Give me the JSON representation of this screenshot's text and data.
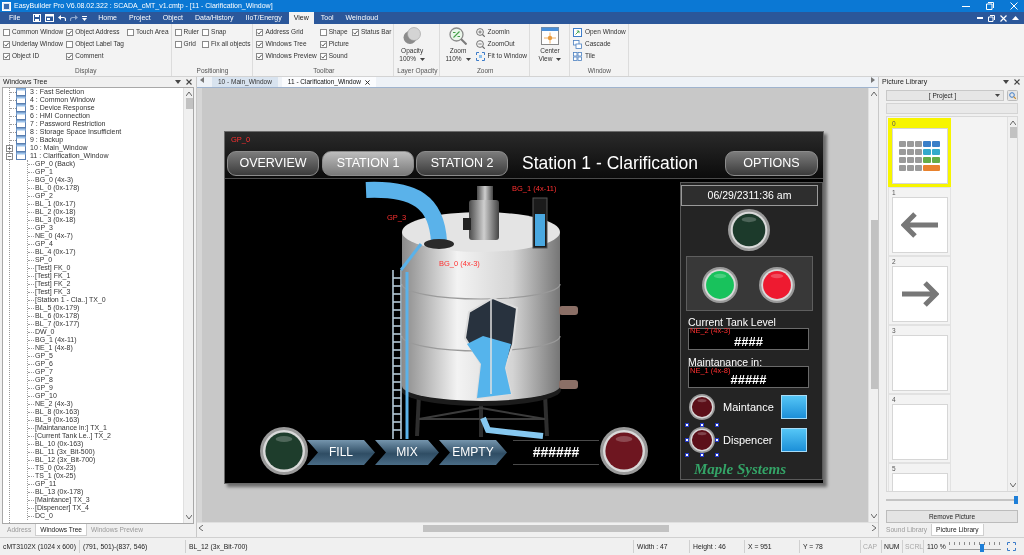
{
  "window": {
    "title": "EasyBuilder Pro V6.08.02.322 : SCADA_cMT_v1.cmtp - [11 - Clarification_Window]"
  },
  "menu": {
    "file": "File",
    "tabs": [
      {
        "label": "Home",
        "selected": false
      },
      {
        "label": "Project",
        "selected": false
      },
      {
        "label": "Object",
        "selected": false
      },
      {
        "label": "Data/History",
        "selected": false
      },
      {
        "label": "IIoT/Energy",
        "selected": false
      },
      {
        "label": "View",
        "selected": true
      },
      {
        "label": "Tool",
        "selected": false
      },
      {
        "label": "Weincloud",
        "selected": false
      }
    ]
  },
  "ribbon": [
    {
      "label": "Display",
      "columns": [
        [
          {
            "kind": "check",
            "label": "Common Window",
            "checked": false
          },
          {
            "kind": "check",
            "label": "Underlay Window",
            "checked": true
          },
          {
            "kind": "check",
            "label": "Object ID",
            "checked": true
          }
        ],
        [
          {
            "kind": "check",
            "label": "Object Address",
            "checked": true
          },
          {
            "kind": "check",
            "label": "Object Label Tag",
            "checked": false
          },
          {
            "kind": "check",
            "label": "Comment",
            "checked": true
          }
        ],
        [
          {
            "kind": "check",
            "label": "Touch Area",
            "checked": false
          }
        ]
      ]
    },
    {
      "label": "Positioning",
      "columns": [
        [
          {
            "kind": "check",
            "label": "Ruler",
            "checked": false
          },
          {
            "kind": "check",
            "label": "Grid",
            "checked": false
          }
        ],
        [
          {
            "kind": "check",
            "label": "Snap",
            "checked": false
          },
          {
            "kind": "check",
            "label": "Fix all objects",
            "checked": false
          }
        ]
      ]
    },
    {
      "label": "Toolbar",
      "columns": [
        [
          {
            "kind": "check",
            "label": "Address Grid",
            "checked": true
          },
          {
            "kind": "check",
            "label": "Windows Tree",
            "checked": true
          },
          {
            "kind": "check",
            "label": "Windows Preview",
            "checked": true
          }
        ],
        [
          {
            "kind": "check",
            "label": "Shape",
            "checked": false
          },
          {
            "kind": "check",
            "label": "Picture",
            "checked": true
          },
          {
            "kind": "check",
            "label": "Sound",
            "checked": true
          }
        ],
        [
          {
            "kind": "check",
            "label": "Status Bar",
            "checked": true
          }
        ]
      ]
    },
    {
      "label": "Layer Opacity",
      "columns": [
        [
          {
            "kind": "large",
            "label": "Opacity",
            "value": "100%"
          }
        ]
      ]
    },
    {
      "label": "Zoom",
      "columns": [
        [
          {
            "kind": "large",
            "label": "Zoom",
            "value": "110%"
          }
        ],
        [
          {
            "kind": "command",
            "label": "ZoomIn"
          },
          {
            "kind": "command",
            "label": "ZoomOut"
          },
          {
            "kind": "command",
            "label": "Fit to Window"
          }
        ]
      ]
    },
    {
      "columns": [
        [
          {
            "kind": "large",
            "label": "Center View"
          }
        ]
      ]
    },
    {
      "label": "Window",
      "columns": [
        [
          {
            "kind": "command",
            "label": "Open Window"
          },
          {
            "kind": "command",
            "label": "Cascade"
          },
          {
            "kind": "command",
            "label": "Tile"
          }
        ]
      ]
    }
  ],
  "windows_tree": {
    "title": "Windows Tree",
    "items": [
      {
        "label": "3 : Fast Selection"
      },
      {
        "label": "4 : Common Window"
      },
      {
        "label": "5 : Device Response"
      },
      {
        "label": "6 : HMI Connection"
      },
      {
        "label": "7 : Password Restriction"
      },
      {
        "label": "8 : Storage Space Insufficient"
      },
      {
        "label": "9 : Backup"
      },
      {
        "label": "10 : Main_Window",
        "expanded": false
      },
      {
        "label": "11 : Clarification_Window",
        "expanded": true,
        "children": [
          {
            "label": "GP_0 (Back)"
          },
          {
            "label": "GP_1"
          },
          {
            "label": "BG_0 (4x-3)"
          },
          {
            "label": "BL_0 (0x-178)"
          },
          {
            "label": "GP_2"
          },
          {
            "label": "BL_1 (0x-17)"
          },
          {
            "label": "BL_2 (0x-18)"
          },
          {
            "label": "BL_3 (0x-18)"
          },
          {
            "label": "GP_3"
          },
          {
            "label": "NE_0 (4x-7)"
          },
          {
            "label": "GP_4"
          },
          {
            "label": "BL_4 (0x-17)"
          },
          {
            "label": "SP_0"
          },
          {
            "label": "[Test] FK_0"
          },
          {
            "label": "[Test] FK_1"
          },
          {
            "label": "[Test] FK_2"
          },
          {
            "label": "[Test] FK_3"
          },
          {
            "label": "[Station 1 - Cla..] TX_0"
          },
          {
            "label": "BL_5 (0x-179)"
          },
          {
            "label": "BL_6 (0x-178)"
          },
          {
            "label": "BL_7 (0x-177)"
          },
          {
            "label": "DW_0"
          },
          {
            "label": "BG_1 (4x-11)"
          },
          {
            "label": "NE_1 (4x-8)"
          },
          {
            "label": "GP_5"
          },
          {
            "label": "GP_6"
          },
          {
            "label": "GP_7"
          },
          {
            "label": "GP_8"
          },
          {
            "label": "GP_9"
          },
          {
            "label": "GP_10"
          },
          {
            "label": "NE_2 (4x-3)"
          },
          {
            "label": "BL_8 (0x-163)"
          },
          {
            "label": "BL_9 (0x-163)"
          },
          {
            "label": "[Maintanance in:] TX_1"
          },
          {
            "label": "[Current Tank Le..] TX_2"
          },
          {
            "label": "BL_10 (0x-163)"
          },
          {
            "label": "BL_11 (3x_Bit-500)"
          },
          {
            "label": "BL_12 (3x_Bit-700)"
          },
          {
            "label": "TS_0 (0x-23)"
          },
          {
            "label": "TS_1 (0x-25)"
          },
          {
            "label": "GP_11"
          },
          {
            "label": "BL_13 (0x-178)"
          },
          {
            "label": "[Maintance] TX_3"
          },
          {
            "label": "[Dispencer] TX_4"
          },
          {
            "label": "DC_0"
          }
        ]
      }
    ],
    "tabs": [
      {
        "label": "Address",
        "selected": false
      },
      {
        "label": "Windows Tree",
        "selected": true
      },
      {
        "label": "Windows Preview",
        "selected": false
      }
    ]
  },
  "editor": {
    "tabs": [
      {
        "label": "10 - Main_Window",
        "selected": false
      },
      {
        "label": "11 - Clarification_Window",
        "selected": true
      }
    ]
  },
  "hmi_screen": {
    "nav_buttons": [
      {
        "label": "OVERVIEW",
        "selected": false
      },
      {
        "label": "STATION 1",
        "selected": true
      },
      {
        "label": "STATION 2",
        "selected": false
      }
    ],
    "title": "Station 1 - Clarification",
    "options_button": "OPTIONS",
    "datetime": "06/29/2311:36 am",
    "lamps": [
      {
        "color": "#1c3a2b"
      },
      {
        "color": "#18c25c"
      },
      {
        "color": "#ee1a30"
      },
      {
        "color": "#1e3d2c"
      },
      {
        "color": "#6e1620"
      }
    ],
    "readouts": [
      {
        "label": "Current Tank Level",
        "value": "####"
      },
      {
        "label": "Maintanance in:",
        "value": "#####"
      }
    ],
    "switches": [
      {
        "label": "Maintance",
        "on": true,
        "selected": false
      },
      {
        "label": "Dispencer",
        "on": true,
        "selected": true
      }
    ],
    "process_steps": [
      "FILL",
      "MIX",
      "EMPTY"
    ],
    "counter": "######",
    "logo": "Maple Systems",
    "object_tags": [
      "GP_0",
      "GP_3",
      "BG_0 (4x-3)",
      "BG_1 (4x-11)",
      "NE_2 (4x-3)",
      "NE_1 (4x-8)"
    ]
  },
  "picture_library": {
    "title": "Picture Library",
    "source": "[ Project ]",
    "pictures": [
      {
        "label": "0",
        "selected": true
      },
      {
        "label": "1",
        "selected": false
      },
      {
        "label": "2",
        "selected": false
      },
      {
        "label": "3",
        "selected": false
      },
      {
        "label": "4",
        "selected": false
      },
      {
        "label": "5",
        "selected": false
      }
    ],
    "size_slider": {
      "level": 1
    },
    "remove_button": "Remove Picture",
    "tabs": [
      {
        "label": "Sound Library",
        "selected": false
      },
      {
        "label": "Picture Library",
        "selected": true
      }
    ]
  },
  "status_bar": {
    "model": "cMT3102X (1024 x 600)",
    "selection_bounds": "(791, 501)-(837, 546)",
    "selected_object": "BL_12 (3x_Bit-700)",
    "width": "Width : 47",
    "height": "Height : 46",
    "x": "X = 951",
    "y": "Y = 78",
    "keys": [
      {
        "label": "CAP",
        "on": false
      },
      {
        "label": "NUM",
        "on": true
      },
      {
        "label": "SCRL",
        "on": false
      }
    ],
    "zoom": "110 %",
    "zoom_slider": {
      "level": 0.65
    }
  }
}
